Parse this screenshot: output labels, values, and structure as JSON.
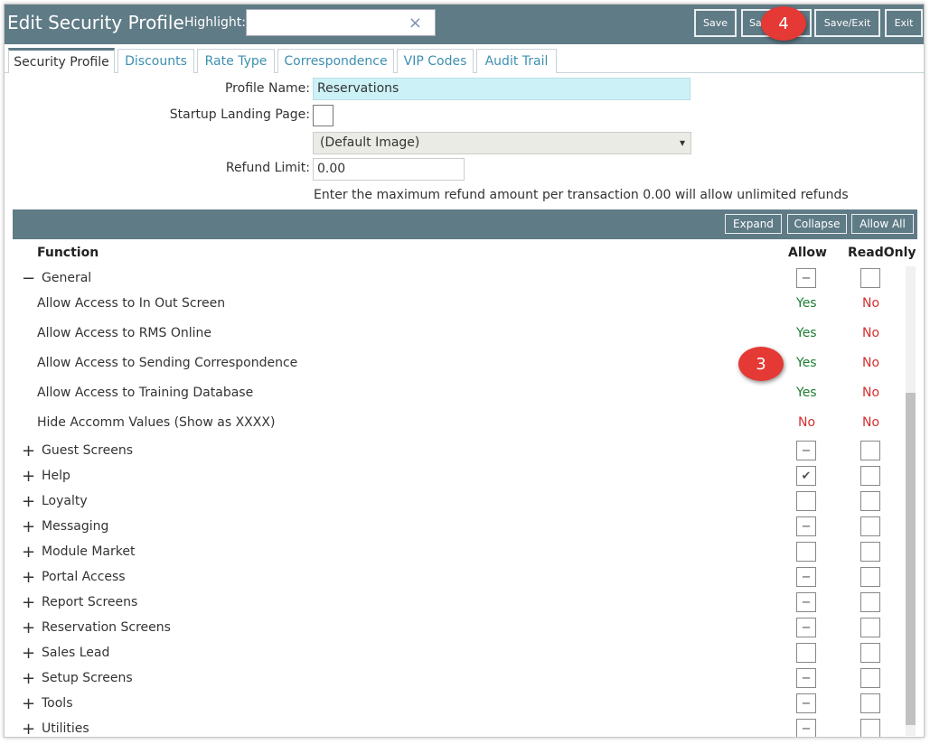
{
  "header": {
    "title": "Edit Security Profile",
    "highlight_label": "Highlight:",
    "highlight_value": "",
    "clear_icon": "×",
    "buttons": {
      "save": "Save",
      "save_new": "Sa",
      "save_exit": "Save/Exit",
      "exit": "Exit"
    }
  },
  "badges": {
    "step4": "4",
    "step3": "3"
  },
  "tabs": [
    "Security Profile",
    "Discounts",
    "Rate Type",
    "Correspondence",
    "VIP Codes",
    "Audit Trail"
  ],
  "form": {
    "profile_name_label": "Profile Name:",
    "profile_name_value": "Reservations",
    "startup_label": "Startup Landing Page:",
    "startup_select": "(Default Image)",
    "refund_label": "Refund Limit:",
    "refund_value": "0.00",
    "refund_hint": "Enter the maximum refund amount per transaction 0.00 will allow unlimited refunds"
  },
  "grid": {
    "buttons": {
      "expand": "Expand",
      "collapse": "Collapse",
      "allow_all": "Allow All"
    },
    "columns": {
      "function": "Function",
      "allow": "Allow",
      "readonly": "ReadOnly"
    },
    "general": {
      "toggle": "−",
      "label": "General",
      "allow": "−",
      "readonly": ""
    },
    "general_items": [
      {
        "label": "Allow Access to In Out Screen",
        "allow": "Yes",
        "readonly": "No"
      },
      {
        "label": "Allow Access to RMS Online",
        "allow": "Yes",
        "readonly": "No"
      },
      {
        "label": "Allow Access to Sending Correspondence",
        "allow": "Yes",
        "readonly": "No"
      },
      {
        "label": "Allow Access to Training Database",
        "allow": "Yes",
        "readonly": "No"
      },
      {
        "label": "Hide Accomm Values (Show as XXXX)",
        "allow": "No",
        "readonly": "No"
      }
    ],
    "groups": [
      {
        "toggle": "+",
        "label": "Guest Screens",
        "allow": "−",
        "readonly": ""
      },
      {
        "toggle": "+",
        "label": "Help",
        "allow": "✔",
        "readonly": ""
      },
      {
        "toggle": "+",
        "label": "Loyalty",
        "allow": "",
        "readonly": ""
      },
      {
        "toggle": "+",
        "label": "Messaging",
        "allow": "−",
        "readonly": ""
      },
      {
        "toggle": "+",
        "label": "Module Market",
        "allow": "",
        "readonly": ""
      },
      {
        "toggle": "+",
        "label": "Portal Access",
        "allow": "−",
        "readonly": ""
      },
      {
        "toggle": "+",
        "label": "Report Screens",
        "allow": "−",
        "readonly": ""
      },
      {
        "toggle": "+",
        "label": "Reservation Screens",
        "allow": "−",
        "readonly": ""
      },
      {
        "toggle": "+",
        "label": "Sales Lead",
        "allow": "",
        "readonly": ""
      },
      {
        "toggle": "+",
        "label": "Setup Screens",
        "allow": "−",
        "readonly": ""
      },
      {
        "toggle": "+",
        "label": "Tools",
        "allow": "−",
        "readonly": ""
      },
      {
        "toggle": "+",
        "label": "Utilities",
        "allow": "−",
        "readonly": ""
      }
    ]
  }
}
